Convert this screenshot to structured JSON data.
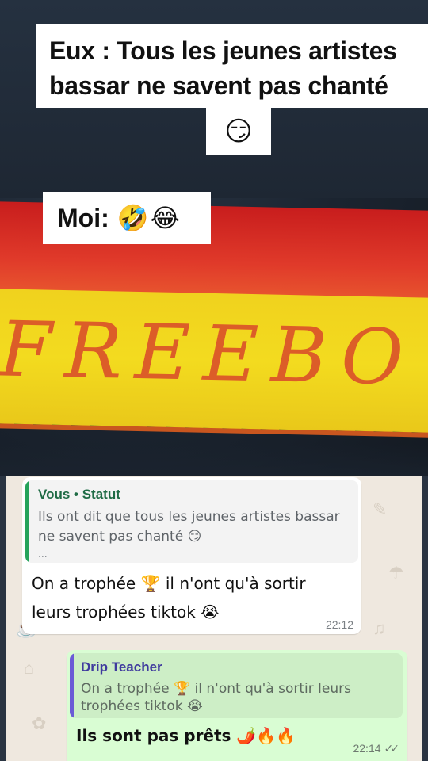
{
  "video_captions": {
    "line1": "Eux : Tous les jeunes artistes",
    "line2": "bassar ne savent pas chanté",
    "line2_emoji": "😏",
    "moi_label": "Moi:",
    "moi_emojis": "🤣😂"
  },
  "photo": {
    "sign_text": "FREEBO"
  },
  "chat": {
    "incoming": {
      "quote_author": "Vous • Statut",
      "quote_text": "Ils ont dit que tous les jeunes artistes bassar ne savent pas chanté 😏",
      "quote_more": "...",
      "message": "On a trophée 🏆 il n'ont qu'à sortir leurs trophées tiktok 😭",
      "time": "22:12"
    },
    "outgoing": {
      "quote_author": "Drip Teacher",
      "quote_text": "On a trophée 🏆 il n'ont qu'à sortir leurs trophées tiktok 😭",
      "message": "Ils sont pas prêts 🌶️🔥🔥",
      "time": "22:14",
      "read_ticks": "✓✓"
    }
  },
  "colors": {
    "incoming_bubble": "#ffffff",
    "outgoing_bubble": "#d9fdd3",
    "status_quote_bar": "#25a35a",
    "reply_quote_bar": "#6b5bd6",
    "sign_red": "#c81d1d",
    "sign_yellow": "#f0d21e"
  }
}
